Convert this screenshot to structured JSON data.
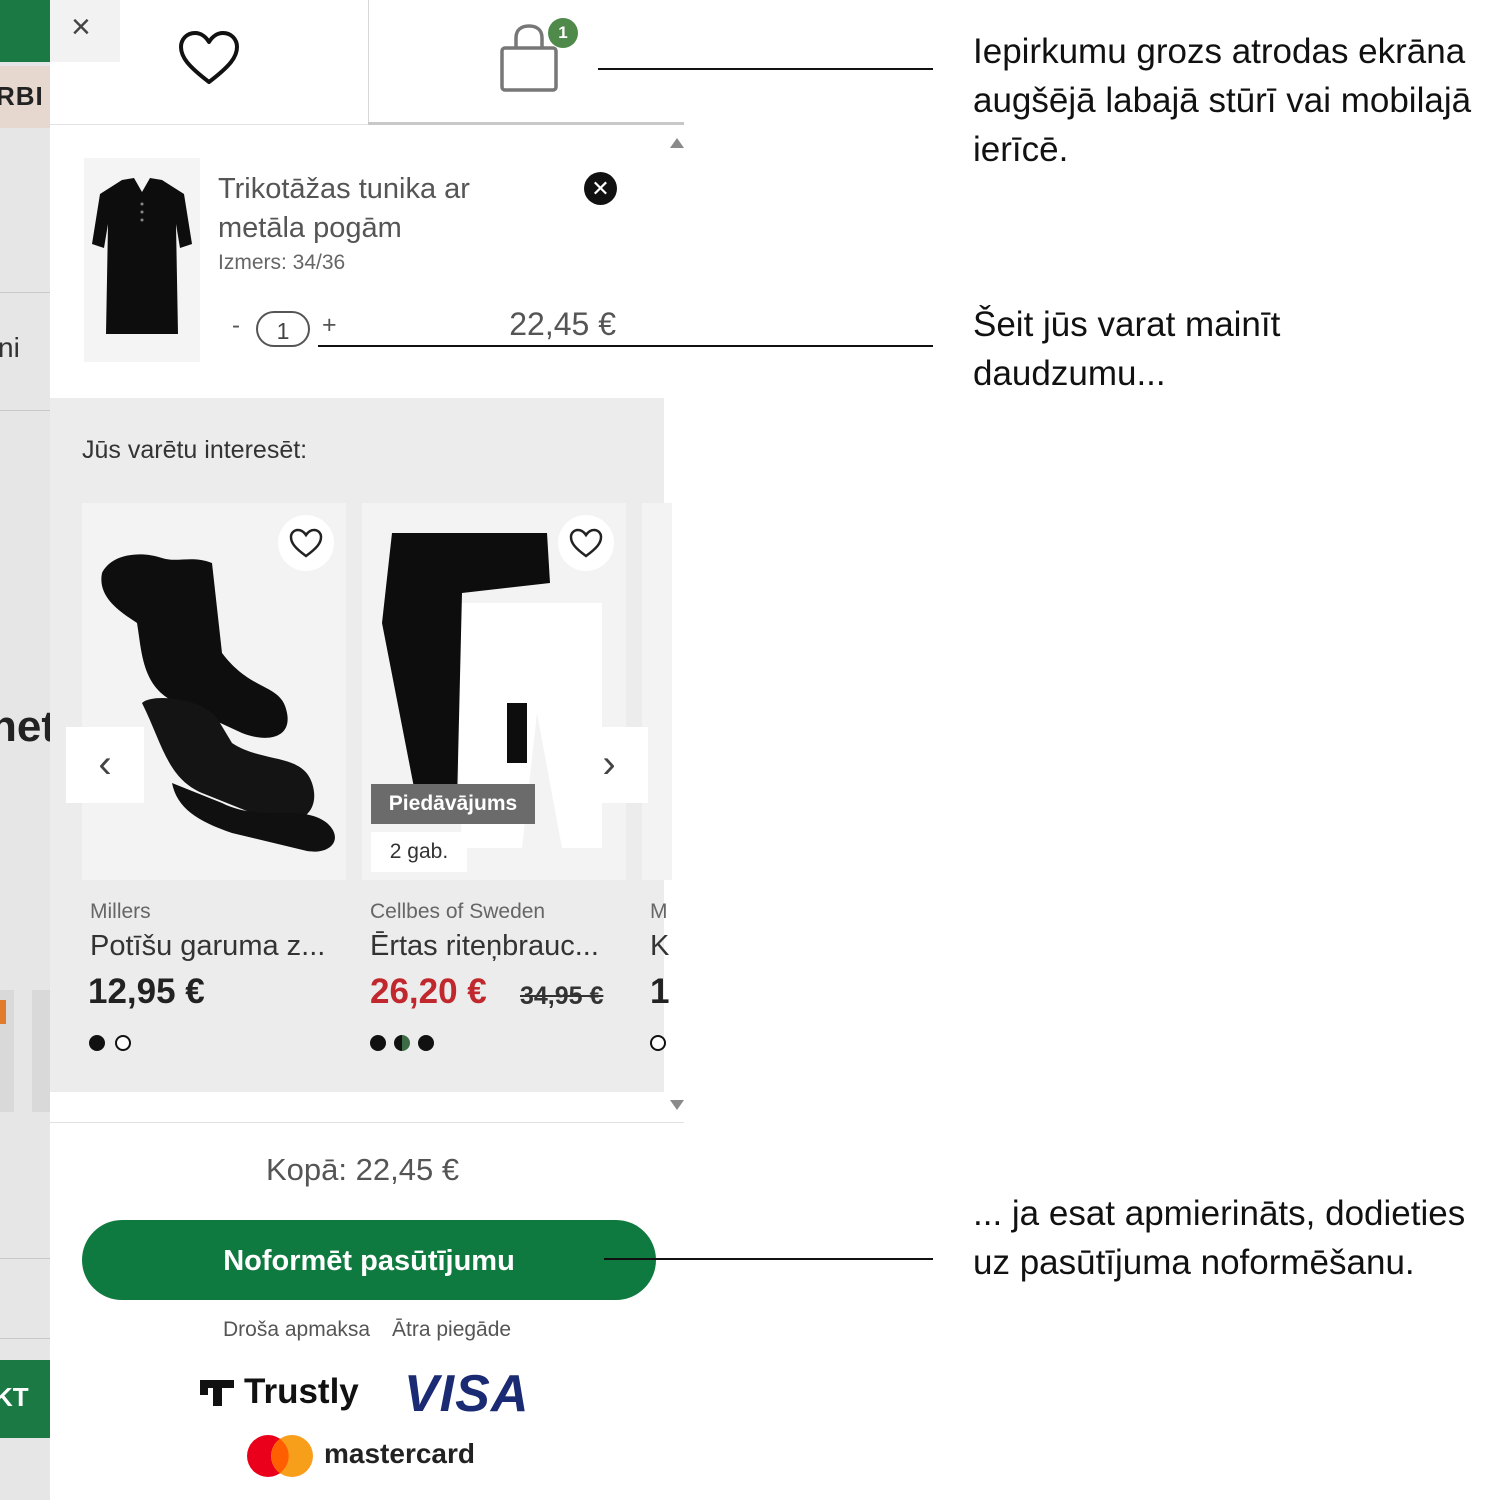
{
  "background": {
    "top_label": "RBI",
    "side_text": "ni",
    "heading_fragment": "net",
    "button_fragment": "KT"
  },
  "header": {
    "close_glyph": "×",
    "cart_count": "1",
    "icons": [
      "close-icon",
      "heart-icon",
      "shopping-bag-icon"
    ]
  },
  "cart_item": {
    "title": "Trikotāžas tunika ar metāla pogām",
    "size": "Izmers: 34/36",
    "quantity": "1",
    "minus": "-",
    "plus": "+",
    "price": "22,45 €",
    "remove_glyph": "✕"
  },
  "recommendations": {
    "title": "Jūs varētu interesēt:",
    "prev": "‹",
    "next": "›",
    "items": [
      {
        "brand": "Millers",
        "name": "Potīšu garuma z...",
        "price": "12,95 €",
        "badge": "",
        "pack": ""
      },
      {
        "brand": "Cellbes of Sweden",
        "name": "Ērtas riteņbrauc...",
        "price": "26,20 €",
        "old_price": "34,95 €",
        "badge": "Piedāvājums",
        "pack": "2 gab."
      },
      {
        "brand": "M",
        "name": "K",
        "price": "1"
      }
    ]
  },
  "footer": {
    "total_label": "Kopā: 22,45 €",
    "checkout": "Noformēt pasūtījumu",
    "trust_secure": "Droša apmaksa",
    "trust_fast": "Ātra piegāde",
    "payment_logos": [
      "Trustly",
      "VISA",
      "mastercard"
    ]
  },
  "annotations": {
    "cart_location": "Iepirkumu grozs atrodas ekrāna augšējā labajā stūrī vai mobilajā ierīcē.",
    "quantity_hint": "Šeit jūs varat mainīt daudzumu...",
    "checkout_hint": "... ja esat apmierināts, dodieties uz pasūtījuma noformēšanu."
  },
  "colors": {
    "brand_green": "#0f7a3f",
    "sale_red": "#c0282d",
    "badge_green": "#4f8a4a"
  }
}
